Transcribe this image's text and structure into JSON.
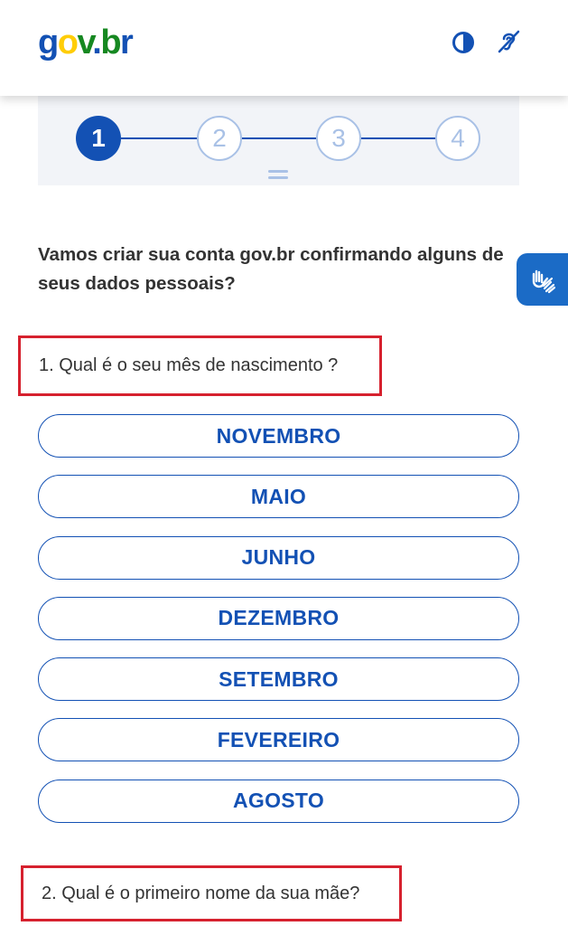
{
  "header": {
    "logo": {
      "g": "g",
      "o": "o",
      "v": "v",
      "dot": ".",
      "b": "b",
      "r": "r"
    },
    "icons": [
      "contrast-icon",
      "hearing-icon"
    ]
  },
  "stepper": {
    "steps": [
      "1",
      "2",
      "3",
      "4"
    ],
    "active_step": "1"
  },
  "intro_text": "Vamos criar sua conta gov.br confirmando alguns de seus dados pessoais?",
  "question1": {
    "label": "1. Qual é o seu mês de nascimento ?",
    "options": [
      "NOVEMBRO",
      "MAIO",
      "JUNHO",
      "DEZEMBRO",
      "SETEMBRO",
      "FEVEREIRO",
      "AGOSTO"
    ]
  },
  "question2": {
    "label": "2. Qual é o primeiro nome da sua mãe?"
  },
  "colors": {
    "primary": "#1351b4",
    "highlight_box": "#d6212e",
    "step_inactive": "#a9c1e6",
    "stepper_bg": "#f2f4f8",
    "vlibras_bg": "#1b6bc6"
  }
}
